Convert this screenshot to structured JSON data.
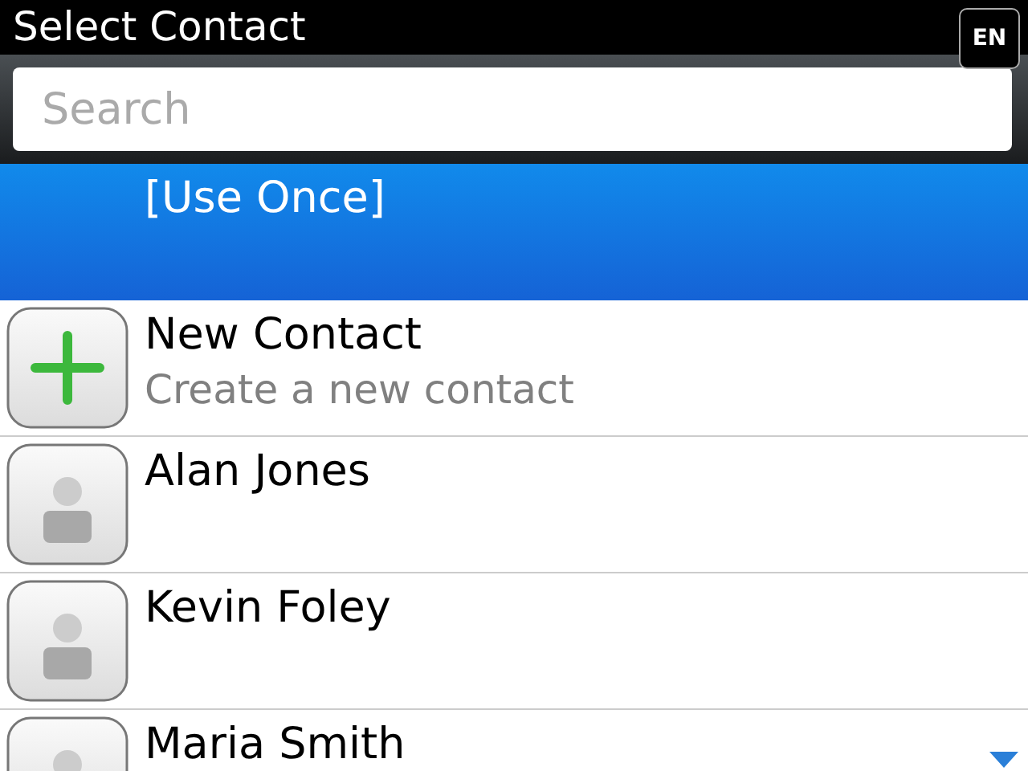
{
  "window": {
    "title": "Select Contact"
  },
  "input_indicator": "EN",
  "search": {
    "placeholder": "Search"
  },
  "items": [
    {
      "kind": "use_once",
      "name": "[Use Once]",
      "selected": true
    },
    {
      "kind": "new",
      "name": "New Contact",
      "subtitle": "Create a new contact",
      "selected": false
    },
    {
      "kind": "contact",
      "name": "Alan Jones",
      "selected": false
    },
    {
      "kind": "contact",
      "name": "Kevin Foley",
      "selected": false
    },
    {
      "kind": "contact",
      "name": "Maria Smith",
      "selected": false
    }
  ]
}
